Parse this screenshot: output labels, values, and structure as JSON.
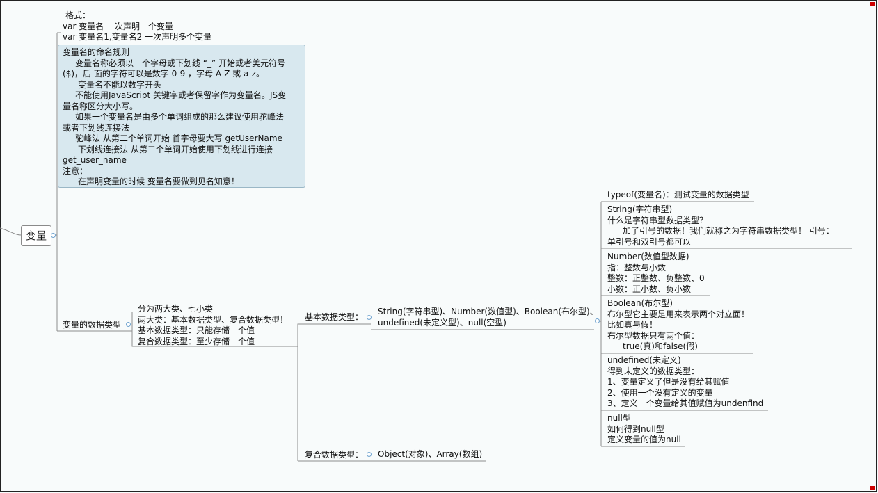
{
  "root": {
    "label": "变量"
  },
  "format": {
    "lines": [
      "格式：",
      "var 变量名  一次声明一个变量",
      "var 变量名1,变量名2    一次声明多个变量"
    ]
  },
  "naming": {
    "lines": [
      "变量名的命名规则",
      "变量名称必须以一个字母或下划线 “_” 开始或者美元符号",
      "($)，后 面的字符可以是数字 0-9 ，字母 A-Z 或 a-z。",
      "变量名不能以数字开头",
      "不能使用JavaScript 关键字或者保留字作为变量名。JS变",
      " 量名称区分大小写。",
      "如果一个变量名是由多个单词组成的那么建议使用驼峰法",
      "或者下划线连接法",
      "驼峰法  从第二个单词开始 首字母要大写  getUserName",
      "下划线连接法  从第二个单词开始使用下划线进行连接",
      "get_user_name",
      " 注意：",
      "在声明变量的时候  变量名要做到见名知意！"
    ]
  },
  "datatypes": {
    "label": "变量的数据类型",
    "summary": [
      "分为两大类、七小类",
      "两大类：基本数据类型、复合数据类型！",
      "基本数据类型：只能存储一个值",
      "复合数据类型：至少存储一个值"
    ],
    "basic_label": "基本数据类型：",
    "basic_items": [
      "String(字符串型)、Number(数值型)、Boolean(布尔型)、",
      "undefined(未定义型)、null(空型)"
    ],
    "compound_label": "复合数据类型：",
    "compound_items": "Object(对象)、Array(数组)"
  },
  "details": {
    "typeof": [
      "typeof(变量名)：测试变量的数据类型"
    ],
    "string": [
      "String(字符串型)",
      "什么是字符串型数据类型？",
      "加了引号的数据！我们就称之为字符串数据类型！ 引号：",
      "单引号和双引号都可以"
    ],
    "number": [
      "Number(数值型数据)",
      "指：整数与小数",
      "整数：正整数、负整数、0",
      "小数：正小数、负小数"
    ],
    "boolean": [
      "Boolean(布尔型)",
      "布尔型它主要是用来表示两个对立面！",
      " 比如真与假！",
      "布尔型数据只有两个值：",
      "true(真)和false(假)"
    ],
    "undefined": [
      "undefined(未定义)",
      " 得到未定义的数据类型：",
      "1、变量定义了但是没有给其赋值",
      "2、使用一个没有定义的变量",
      "3、定义一个变量给其值赋值为undenfind"
    ],
    "null": [
      "null型",
      "如何得到null型",
      "定义变量的值为null"
    ]
  },
  "colors": {
    "line": "#8c8c8c",
    "callout_bg": "#d8e8ef",
    "toggle": "#6fa3cf",
    "marker": "#cc0000"
  }
}
